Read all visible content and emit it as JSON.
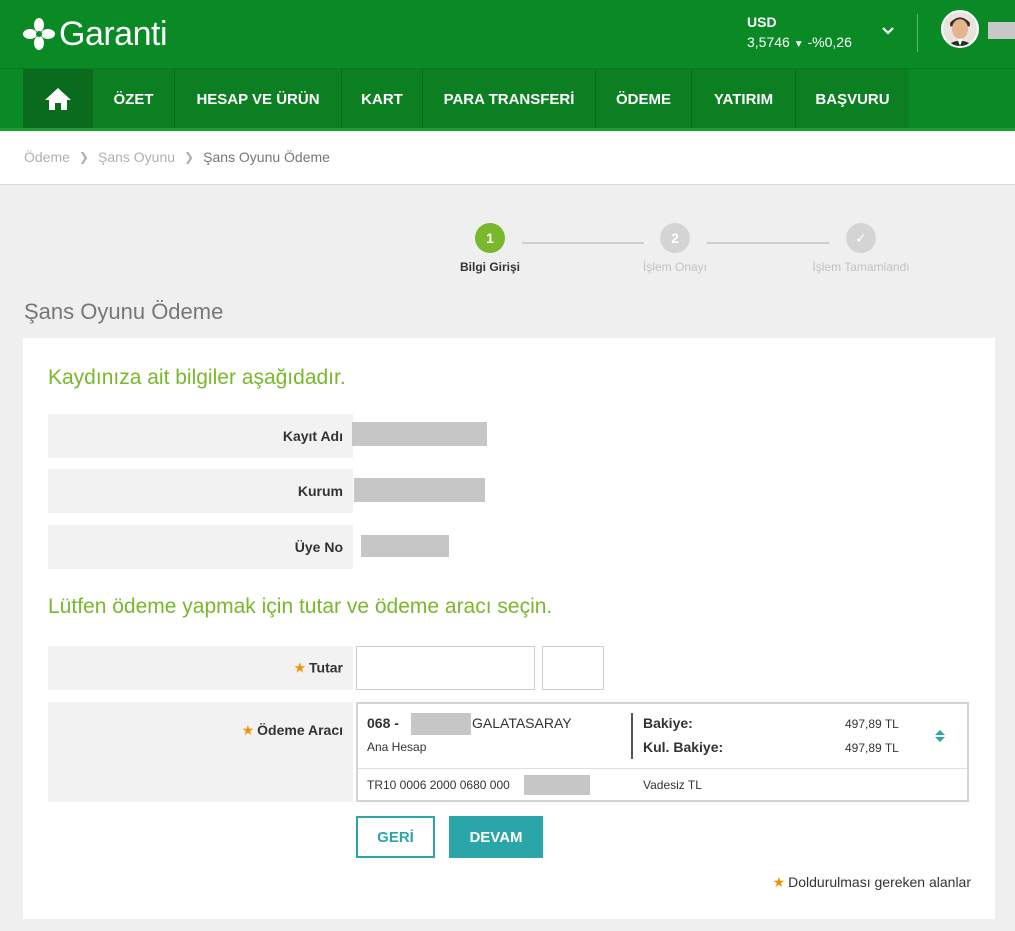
{
  "brand": {
    "name": "Garanti",
    "accent": "#0a8a24",
    "teal": "#2aa6a8",
    "green_title": "#78b82a",
    "orange_star": "#f39200"
  },
  "currency": {
    "code": "USD",
    "rate": "3,5746",
    "change": "-%0,26",
    "trend_icon": "down-triangle-icon"
  },
  "nav": {
    "home_icon": "home-icon",
    "items": [
      {
        "label": "ÖZET"
      },
      {
        "label": "HESAP VE ÜRÜN"
      },
      {
        "label": "KART"
      },
      {
        "label": "PARA TRANSFERİ"
      },
      {
        "label": "ÖDEME"
      },
      {
        "label": "YATIRIM"
      },
      {
        "label": "BAŞVURU"
      }
    ]
  },
  "breadcrumb": [
    "Ödeme",
    "Şans Oyunu",
    "Şans Oyunu Ödeme"
  ],
  "steps": [
    {
      "num": "1",
      "label": "Bilgi Girişi",
      "state": "active"
    },
    {
      "num": "2",
      "label": "İşlem Onayı",
      "state": "pending"
    },
    {
      "num": "✓",
      "label": "İşlem Tamamlandı",
      "state": "pending"
    }
  ],
  "page_title": "Şans Oyunu Ödeme",
  "info": {
    "title": "Kaydınıza ait bilgiler aşağıdadır.",
    "rows": [
      {
        "label": "Kayıt Adı"
      },
      {
        "label": "Kurum"
      },
      {
        "label": "Üye No"
      }
    ]
  },
  "payment": {
    "title": "Lütfen ödeme yapmak için tutar ve ödeme aracı seçin.",
    "amount_label": "Tutar",
    "amount_value": "",
    "amount_decimal": "",
    "tool_label": "Ödeme Aracı",
    "account": {
      "branch": "068 -",
      "branch_name": "GALATASARAY",
      "type": "Ana Hesap",
      "balance_label": "Bakiye:",
      "balance": "497,89 TL",
      "usable_label": "Kul. Bakiye:",
      "usable": "497,89 TL",
      "iban": "TR10 0006 2000 0680 000",
      "currency_type": "Vadesiz TL"
    }
  },
  "buttons": {
    "back": "GERİ",
    "next": "DEVAM"
  },
  "required_note": "Doldurulması gereken alanlar"
}
